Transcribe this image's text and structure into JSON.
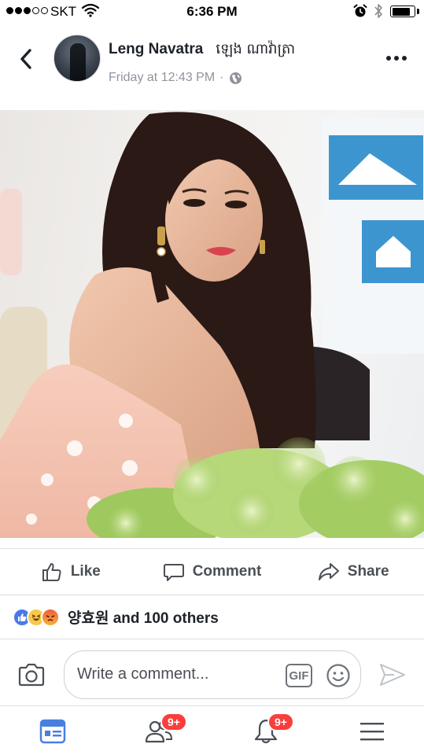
{
  "status_bar": {
    "carrier": "SKT",
    "time": "6:36 PM",
    "signal_bars_filled": 3,
    "signal_bars_total": 5,
    "battery_level": 0.85,
    "icons": [
      "wifi-icon",
      "alarm-icon",
      "bluetooth-icon",
      "battery-icon"
    ]
  },
  "post": {
    "author": "Leng Navatra",
    "author_khmer": "ឡេង ណាវ៉ាត្រា",
    "timestamp": "Friday at 12:43 PM",
    "separator": "·",
    "privacy_icon": "globe-icon"
  },
  "actions": {
    "like": "Like",
    "comment": "Comment",
    "share": "Share"
  },
  "reactions": {
    "icons": [
      "like-reaction-icon",
      "haha-reaction-icon",
      "angry-reaction-icon"
    ],
    "summary": "양효원 and 100 others"
  },
  "composer": {
    "placeholder": "Write a comment...",
    "gif_label": "GIF"
  },
  "tab_bar": {
    "tabs": [
      {
        "name": "news-feed",
        "icon": "news-feed-icon",
        "active": true,
        "badge": ""
      },
      {
        "name": "friend-requests",
        "icon": "friends-icon",
        "active": false,
        "badge": "9+"
      },
      {
        "name": "notifications",
        "icon": "bell-icon",
        "active": false,
        "badge": "9+"
      },
      {
        "name": "menu",
        "icon": "hamburger-menu-icon",
        "active": false,
        "badge": ""
      }
    ]
  },
  "colors": {
    "facebook_blue": "#4267b2",
    "active_tab": "#4a7fe0",
    "icon_gray": "#4b4f56",
    "badge_red": "#fa3e3e",
    "divider": "#dddfe2"
  }
}
